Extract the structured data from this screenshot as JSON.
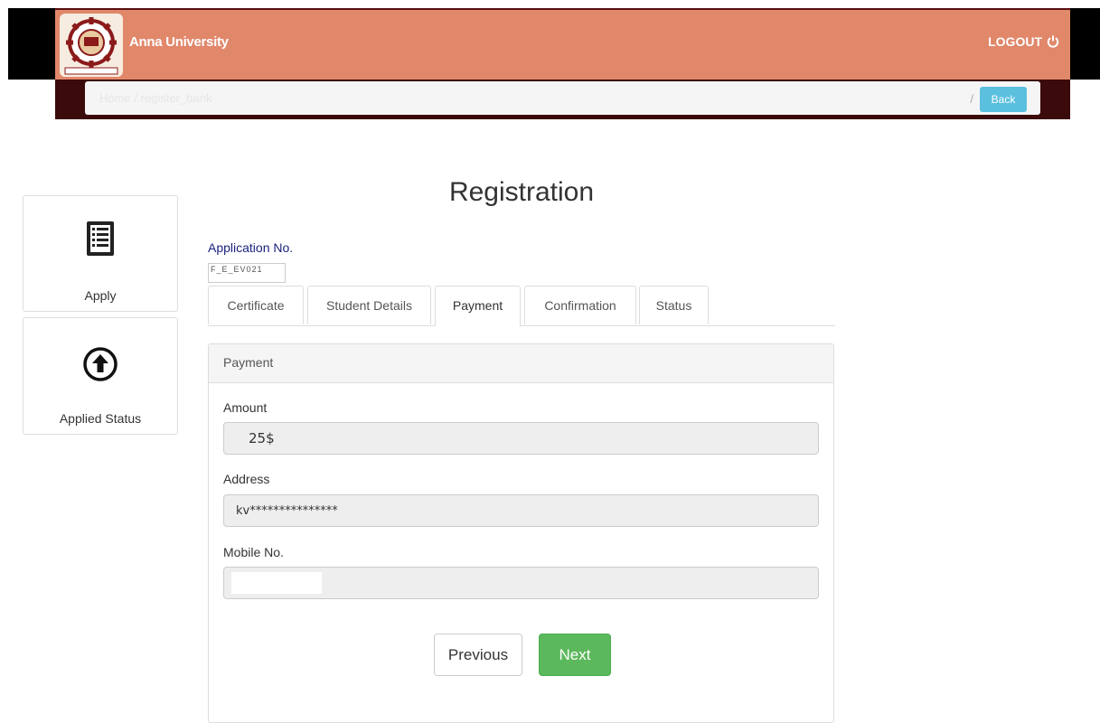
{
  "header": {
    "brand": "Anna University",
    "logout_label": "LOGOUT",
    "colors": {
      "header_bg": "#e1876a",
      "crumb_bar": "#3b0a0a"
    }
  },
  "breadcrumb": {
    "items": [
      "Home",
      "register_bank"
    ],
    "back_label": "Back"
  },
  "sidebar": {
    "cards": [
      {
        "label": "Apply",
        "icon": "list-icon"
      },
      {
        "label": "Applied Status",
        "icon": "upload-circle-icon"
      }
    ]
  },
  "main": {
    "title": "Registration",
    "application_label": "Application No.",
    "application_value": "F_E_EV021",
    "tabs": [
      {
        "label": "Certificate"
      },
      {
        "label": "Student Details"
      },
      {
        "label": "Payment"
      },
      {
        "label": "Confirmation"
      },
      {
        "label": "Status"
      }
    ],
    "active_tab": "Payment",
    "panel": {
      "heading": "Payment",
      "fields": [
        {
          "label": "Amount",
          "value": "25$"
        },
        {
          "label": "Address",
          "value": "kv***************"
        },
        {
          "label": "Mobile No.",
          "value": ""
        }
      ]
    },
    "buttons": {
      "previous": "Previous",
      "next": "Next"
    }
  }
}
